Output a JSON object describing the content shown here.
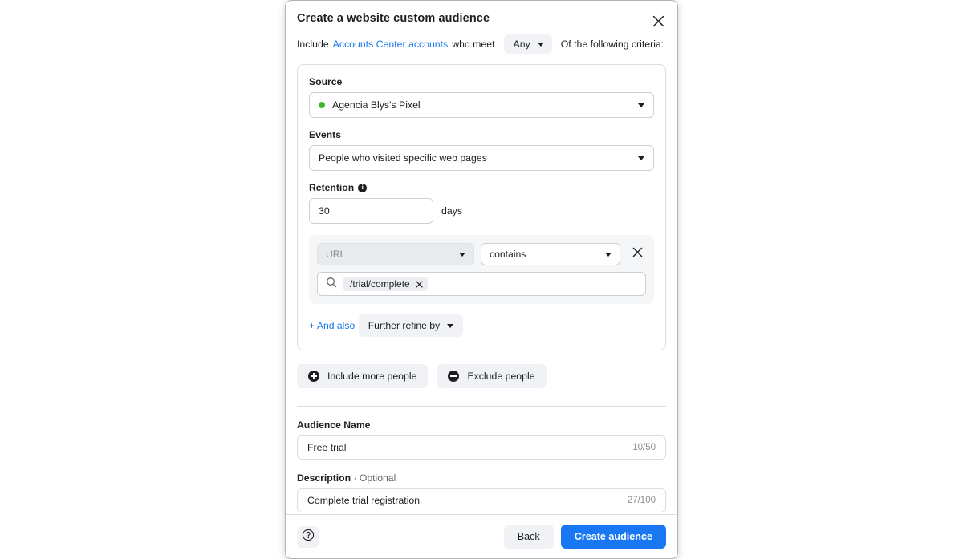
{
  "modal": {
    "title": "Create a website custom audience",
    "close_icon": "close-icon",
    "include_line": {
      "prefix": "Include",
      "link": "Accounts Center accounts",
      "middle": "who meet",
      "match_value": "Any",
      "suffix": "Of the following criteria:"
    },
    "criteria": {
      "source_label": "Source",
      "source_value": "Agencia Blys's Pixel",
      "source_status_color": "#42b72a",
      "events_label": "Events",
      "events_value": "People who visited specific web pages",
      "retention_label": "Retention",
      "retention_value": "30",
      "retention_unit": "days",
      "rule": {
        "field_value": "URL",
        "operator_value": "contains",
        "remove_icon": "close-icon",
        "search_icon": "search-icon",
        "token_value": "/trial/complete",
        "token_remove_icon": "close-icon"
      },
      "and_also_label": "+ And also",
      "refine_label": "Further refine by"
    },
    "include_more_label": "Include more people",
    "exclude_label": "Exclude people",
    "audience_name_label": "Audience Name",
    "audience_name_value": "Free trial",
    "audience_name_counter": "10/50",
    "description_label": "Description",
    "description_optional": " · Optional",
    "description_value": "Complete trial registration",
    "description_counter": "27/100",
    "footer": {
      "help_icon": "help-icon",
      "back_label": "Back",
      "create_label": "Create audience",
      "primary_color": "#1877f2"
    }
  }
}
